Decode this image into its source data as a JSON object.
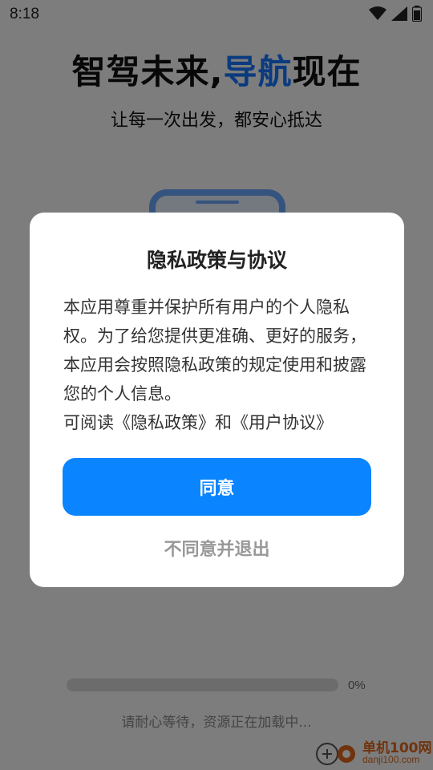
{
  "status_bar": {
    "time": "8:18",
    "icons": [
      "wifi-icon",
      "cellular-signal-icon",
      "battery-icon"
    ]
  },
  "hero": {
    "title_part1": "智驾未来,",
    "title_accent": "导航",
    "title_part2": "现在",
    "subtitle": "让每一次出发，都安心抵达"
  },
  "modal": {
    "title": "隐私政策与协议",
    "body": "本应用尊重并保护所有用户的个人隐私权。为了给您提供更准确、更好的服务，本应用会按照隐私政策的规定使用和披露您的个人信息。",
    "links_prefix": "可阅读",
    "privacy_link": "《隐私政策》",
    "links_and": "和",
    "user_agreement_link": "《用户协议》",
    "agree_label": "同意",
    "disagree_label": "不同意并退出"
  },
  "loading": {
    "progress_percent": 0,
    "progress_label": "0%",
    "message": "请耐心等待，资源正在加载中..."
  },
  "watermark": {
    "site_name": "单机100网",
    "url": "danji100.com"
  },
  "colors": {
    "accent": "#1677ff",
    "button": "#0a84ff",
    "watermark": "#e0661a"
  }
}
